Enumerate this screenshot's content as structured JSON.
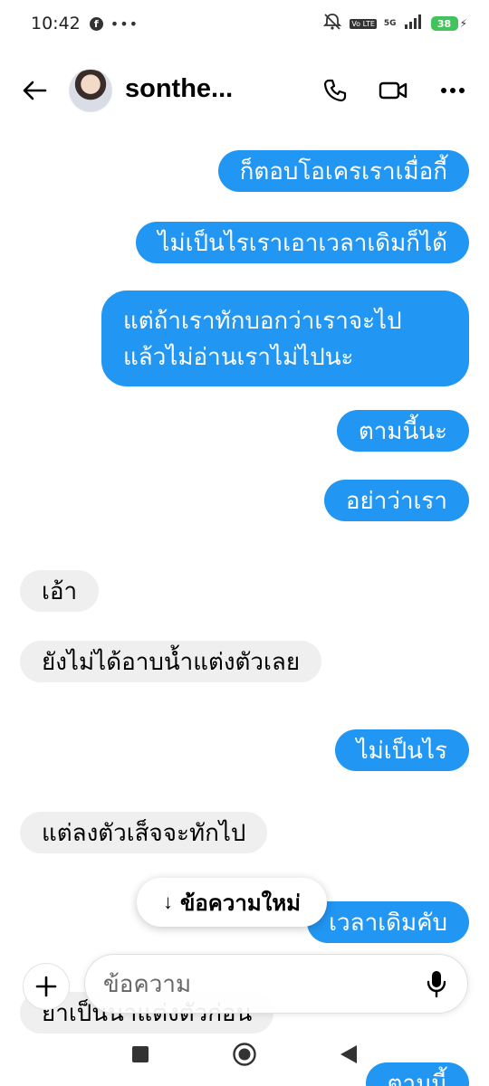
{
  "status_bar": {
    "time": "10:42",
    "fb_glyph": "f",
    "dots": "•••",
    "volte": "Vo LTE",
    "network": "5G",
    "battery_level": "38",
    "icons": [
      "facebook-icon",
      "mute-icon",
      "volte-icon",
      "signal-icon",
      "battery-icon",
      "charging-icon"
    ]
  },
  "header": {
    "contact_name": "sonthe...",
    "icons": [
      "back-arrow-icon",
      "phone-icon",
      "video-icon",
      "more-icon"
    ]
  },
  "messages": [
    {
      "side": "out",
      "text": "ก็ตอบโอเครเราเมื่อกี้"
    },
    {
      "side": "out",
      "text": "ไม่เป็นไรเราเอาเวลาเดิมก็ได้"
    },
    {
      "side": "out",
      "text": "แต่ถ้าเราทักบอกว่าเราจะไป แล้วไม่อ่านเราไม่ไปนะ"
    },
    {
      "side": "out",
      "text": "ตามนี้นะ"
    },
    {
      "side": "out",
      "text": "อย่าว่าเรา"
    },
    {
      "side": "in",
      "text": "เอ้า"
    },
    {
      "side": "in",
      "text": "ยังไม่ได้อาบน้ำแต่งตัวเลย"
    },
    {
      "side": "out",
      "text": "ไม่เป็นไร"
    },
    {
      "side": "in",
      "text": "แต่ลงตัวเส็จจะทักไป"
    },
    {
      "side": "out",
      "text": "เวลาเดิมคับ"
    },
    {
      "side": "in",
      "text": "ยาเป็นนาแต่งตัวก่อน"
    },
    {
      "side": "out",
      "text": "ตามนี้"
    }
  ],
  "new_messages_pill": {
    "arrow": "↓",
    "label": "ข้อความใหม่"
  },
  "composer": {
    "placeholder": "ข้อความ",
    "plus_glyph": "+"
  },
  "nav_bar": {
    "icons": [
      "recents-square-icon",
      "home-circle-icon",
      "back-triangle-icon"
    ]
  },
  "colors": {
    "outgoing_bubble": "#2196f3",
    "incoming_bubble": "#efefef",
    "battery": "#43c35b"
  }
}
